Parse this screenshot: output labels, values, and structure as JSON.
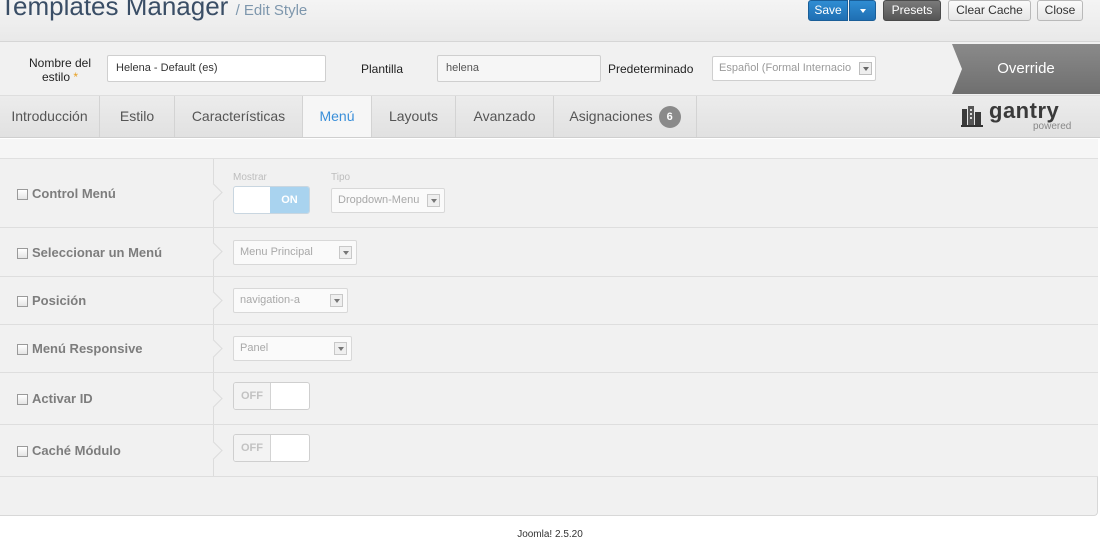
{
  "header": {
    "title": "Templates Manager",
    "subtitle": "/ Edit Style",
    "buttons": {
      "save": "Save",
      "presets": "Presets",
      "clear_cache": "Clear Cache",
      "close": "Close"
    }
  },
  "details": {
    "name_label": "Nombre del estilo",
    "required_mark": "*",
    "name_value": "Helena - Default (es)",
    "template_label": "Plantilla",
    "template_value": "helena",
    "default_label": "Predeterminado",
    "default_value": "Español (Formal Internacio",
    "override_label": "Override"
  },
  "tabs": [
    {
      "label": "Introducción"
    },
    {
      "label": "Estilo"
    },
    {
      "label": "Características"
    },
    {
      "label": "Menú"
    },
    {
      "label": "Layouts"
    },
    {
      "label": "Avanzado"
    },
    {
      "label": "Asignaciones",
      "badge": "6"
    }
  ],
  "active_tab": "Menú",
  "logo": {
    "name": "gantry",
    "tagline": "powered"
  },
  "settings": {
    "control_menu": {
      "label": "Control Menú",
      "mostrar_label": "Mostrar",
      "tipo_label": "Tipo",
      "toggle": "ON",
      "tipo_value": "Dropdown-Menu"
    },
    "select_menu": {
      "label": "Seleccionar un Menú",
      "value": "Menu Principal"
    },
    "position": {
      "label": "Posición",
      "value": "navigation-a"
    },
    "responsive": {
      "label": "Menú Responsive",
      "value": "Panel"
    },
    "activate_id": {
      "label": "Activar ID",
      "toggle": "OFF"
    },
    "cache_module": {
      "label": "Caché Módulo",
      "toggle": "OFF"
    }
  },
  "footer": {
    "version": "Joomla! 2.5.20"
  },
  "colors": {
    "primary_button": "#1f6fb3",
    "active_tab_text": "#3a8fd9",
    "toggle_on": "#a9d3ef",
    "override_bg": "#7a7a7a"
  }
}
